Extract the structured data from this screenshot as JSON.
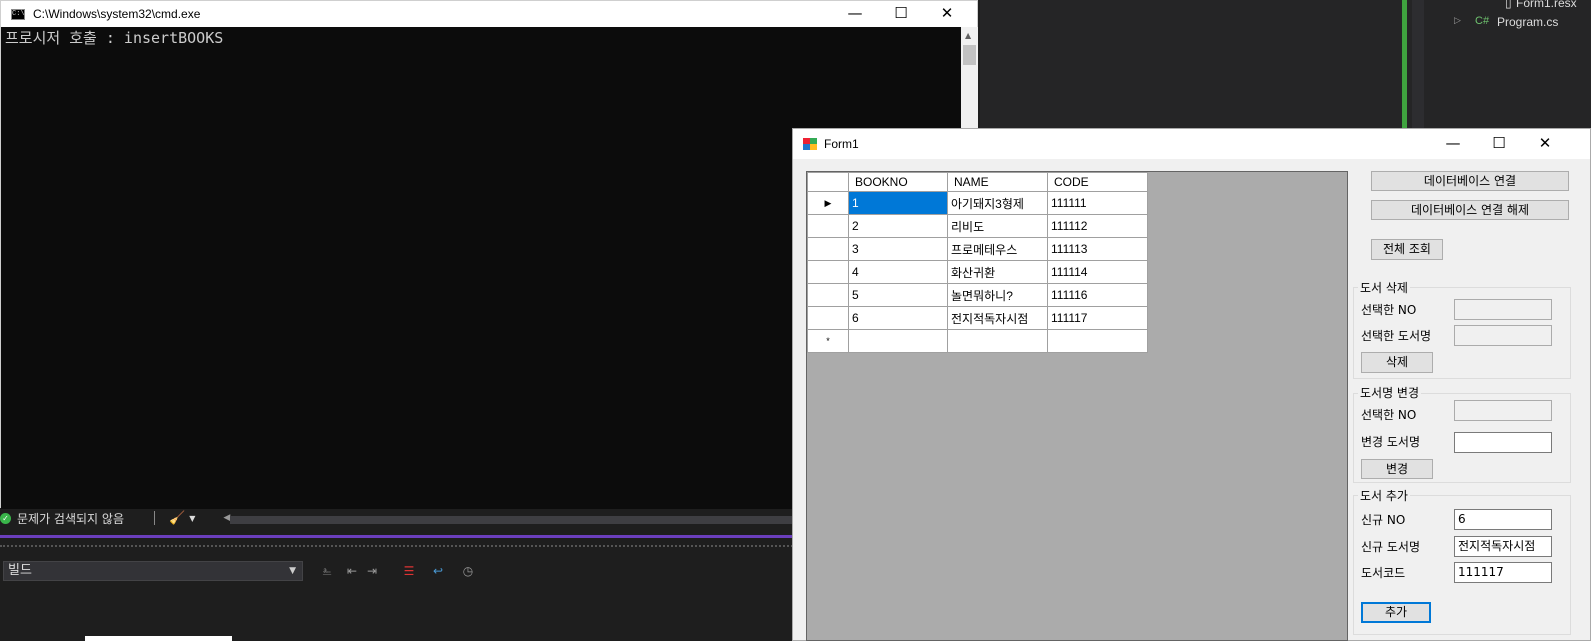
{
  "vs": {
    "solution_items": [
      "Form1.resx",
      "Program.cs"
    ],
    "status_text": "문제가 검색되지 않음",
    "build_combo": "빌드"
  },
  "cmd": {
    "title": "C:\\Windows\\system32\\cmd.exe",
    "output": "프로시저 호출 : insertBOOKS"
  },
  "window_controls": {
    "minimize": "—",
    "maximize": "☐",
    "close": "✕"
  },
  "form": {
    "title": "Form1",
    "grid": {
      "columns": [
        "BOOKNO",
        "NAME",
        "CODE"
      ],
      "rows": [
        [
          "1",
          "아기돼지3형제",
          "111111"
        ],
        [
          "2",
          "리비도",
          "111112"
        ],
        [
          "3",
          "프로메테우스",
          "111113"
        ],
        [
          "4",
          "화산귀환",
          "111114"
        ],
        [
          "5",
          "놀면뭐하니?",
          "111116"
        ],
        [
          "6",
          "전지적독자시점",
          "111117"
        ]
      ],
      "current_row_marker": "▶",
      "new_row_marker": "*"
    },
    "buttons": {
      "connect": "데이터베이스 연결",
      "disconnect": "데이터베이스 연결 해제",
      "view_all": "전체 조회"
    },
    "delete_group": {
      "title": "도서 삭제",
      "no_label": "선택한 NO",
      "name_label": "선택한 도서명",
      "no_value": "",
      "name_value": "",
      "button": "삭제"
    },
    "update_group": {
      "title": "도서명 변경",
      "no_label": "선택한 NO",
      "name_label": "변경 도서명",
      "no_value": "",
      "name_value": "",
      "button": "변경"
    },
    "add_group": {
      "title": "도서 추가",
      "no_label": "신규 NO",
      "name_label": "신규 도서명",
      "code_label": "도서코드",
      "no_value": "6",
      "name_value": "전지적독자시점",
      "code_value": "111117",
      "button": "추가"
    }
  }
}
